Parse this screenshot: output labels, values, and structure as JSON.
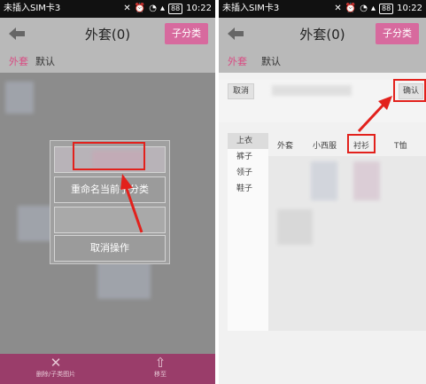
{
  "status_bar": {
    "carrier": "未插入SIM卡3",
    "battery": "88",
    "time": "10:22"
  },
  "left_screen": {
    "title": "外套(0)",
    "action_button": "子分类",
    "tabs": [
      "外套",
      "默认"
    ],
    "modal": {
      "items": [
        "重命名当前子分类",
        "取消操作"
      ]
    },
    "bottom_bar": [
      {
        "icon": "close-icon",
        "label": "删除/子类图片"
      },
      {
        "icon": "upload-icon",
        "label": "移至"
      }
    ]
  },
  "right_screen": {
    "title": "外套(0)",
    "action_button": "子分类",
    "tabs": [
      "外套",
      "默认"
    ],
    "dialog": {
      "cancel_label": "取消",
      "confirm_label": "确认"
    },
    "categories": [
      "上衣",
      "裤子",
      "领子",
      "鞋子"
    ],
    "subcategories": [
      "外套",
      "小西服",
      "衬衫",
      "T恤"
    ]
  },
  "colors": {
    "accent": "#d76a9e",
    "annotation_red": "#e2211c",
    "bottom_bar": "#9a3d6a"
  }
}
